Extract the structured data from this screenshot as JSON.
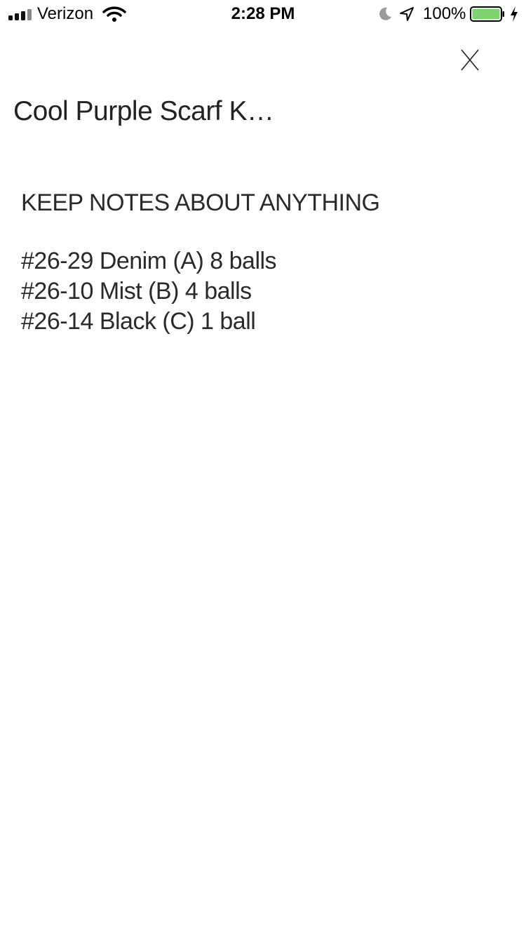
{
  "status_bar": {
    "carrier": "Verizon",
    "time": "2:28 PM",
    "battery_percent": "100%",
    "battery_level": 1.0,
    "battery_color": "#7ed36f",
    "icons": [
      "signal-icon",
      "wifi-icon",
      "moon-icon",
      "location-arrow-icon",
      "battery-icon",
      "charging-bolt-icon"
    ]
  },
  "header": {
    "close_label": "X",
    "close_icon": "close-icon"
  },
  "note": {
    "title": "Cool Purple Scarf K…",
    "lines": [
      "KEEP NOTES ABOUT ANYTHING",
      "",
      "#26-29 Denim (A) 8 balls",
      "#26-10 Mist (B) 4 balls",
      "#26-14 Black (C) 1 ball"
    ]
  }
}
